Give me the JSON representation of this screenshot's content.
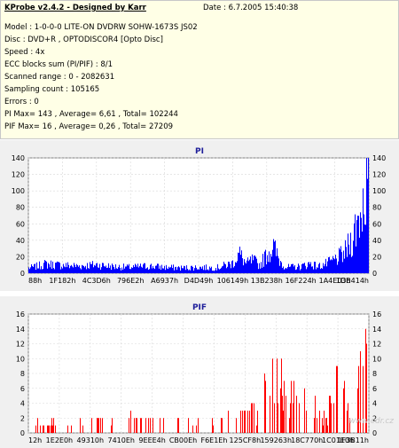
{
  "info": {
    "title": "KProbe v2.4.2 - Designed by Karr",
    "date": "Date : 6.7.2005 15:40:38",
    "lines": [
      "Model : 1-0-0-0 LITE-ON DVDRW SOHW-1673S JS02",
      "Disc : DVD+R , OPTODISCOR4 [Opto Disc]",
      "Speed : 4x",
      "ECC blocks sum (PI/PIF) : 8/1",
      "Scanned range : 0 - 2082631",
      "Sampling count : 105165",
      "Errors : 0",
      "PI Max= 143 , Average= 6,61 , Total= 102244",
      "PIF Max= 16 , Average= 0,26 , Total= 27209"
    ]
  },
  "watermark": "www.cdr.cz",
  "chart_data": [
    {
      "type": "bar",
      "title": "PI",
      "color": "#0000ff",
      "ylim": [
        0,
        140
      ],
      "yticks": [
        0,
        20,
        40,
        60,
        80,
        100,
        120,
        140
      ],
      "xticks": [
        "88h",
        "1F182h",
        "4C3D6h",
        "796E2h",
        "A6937h",
        "D4D49h",
        "106149h",
        "13B238h",
        "16F224h",
        "1A4E03h",
        "1DB414h"
      ],
      "profile": [
        [
          0,
          8
        ],
        [
          0.02,
          10
        ],
        [
          0.05,
          14
        ],
        [
          0.1,
          12
        ],
        [
          0.15,
          11
        ],
        [
          0.2,
          13
        ],
        [
          0.25,
          10
        ],
        [
          0.3,
          9
        ],
        [
          0.35,
          11
        ],
        [
          0.4,
          9
        ],
        [
          0.45,
          8
        ],
        [
          0.5,
          9
        ],
        [
          0.55,
          8
        ],
        [
          0.6,
          15
        ],
        [
          0.62,
          30
        ],
        [
          0.64,
          14
        ],
        [
          0.66,
          20
        ],
        [
          0.68,
          12
        ],
        [
          0.7,
          28
        ],
        [
          0.72,
          40
        ],
        [
          0.74,
          18
        ],
        [
          0.76,
          9
        ],
        [
          0.8,
          10
        ],
        [
          0.83,
          15
        ],
        [
          0.85,
          10
        ],
        [
          0.88,
          15
        ],
        [
          0.9,
          20
        ],
        [
          0.93,
          30
        ],
        [
          0.95,
          50
        ],
        [
          0.97,
          80
        ],
        [
          0.985,
          110
        ],
        [
          0.995,
          140
        ],
        [
          1,
          143
        ]
      ]
    },
    {
      "type": "bar",
      "title": "PIF",
      "color": "#ff0000",
      "ylim": [
        0,
        16
      ],
      "yticks": [
        0,
        2,
        4,
        6,
        8,
        10,
        12,
        14,
        16
      ],
      "xticks": [
        "12h",
        "1E2E0h",
        "49310h",
        "7410Eh",
        "9EEE4h",
        "CB00Eh",
        "F6E1Eh",
        "125CF8h",
        "159263h",
        "18C770h",
        "1C01E0h",
        "1F3B11h"
      ],
      "profile": [
        [
          0,
          1
        ],
        [
          0.1,
          1
        ],
        [
          0.2,
          2
        ],
        [
          0.3,
          2
        ],
        [
          0.4,
          2
        ],
        [
          0.5,
          2
        ],
        [
          0.55,
          2
        ],
        [
          0.6,
          3
        ],
        [
          0.65,
          4
        ],
        [
          0.68,
          6
        ],
        [
          0.7,
          8
        ],
        [
          0.72,
          10
        ],
        [
          0.74,
          12
        ],
        [
          0.76,
          6
        ],
        [
          0.78,
          8
        ],
        [
          0.8,
          11
        ],
        [
          0.82,
          12
        ],
        [
          0.84,
          6
        ],
        [
          0.86,
          3
        ],
        [
          0.88,
          4
        ],
        [
          0.9,
          8
        ],
        [
          0.92,
          10
        ],
        [
          0.94,
          6
        ],
        [
          0.96,
          8
        ],
        [
          0.98,
          12
        ],
        [
          0.99,
          16
        ],
        [
          1,
          16
        ]
      ]
    }
  ]
}
